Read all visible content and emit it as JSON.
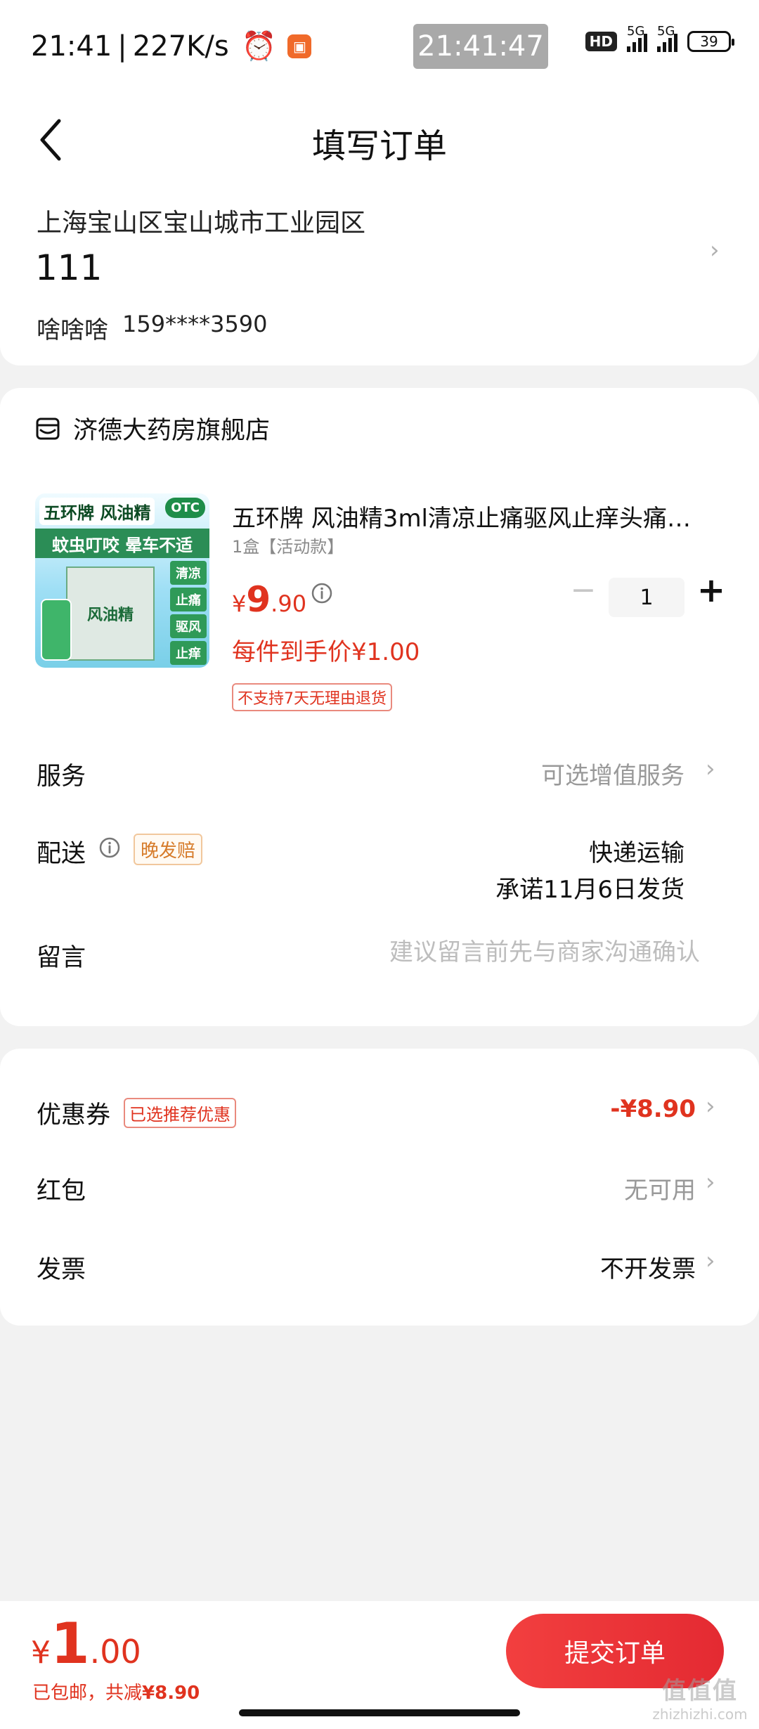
{
  "status_bar": {
    "time": "21:41",
    "separator": "|",
    "network_speed": "227K/s",
    "clock_overlay": "21:41:47",
    "hd_label": "HD",
    "net_1": "5G",
    "net_2": "5G",
    "battery": "39"
  },
  "header": {
    "title": "填写订单"
  },
  "address": {
    "region": "上海宝山区宝山城市工业园区",
    "detail": "111",
    "name": "啥啥啥",
    "phone": "159****3590"
  },
  "store": {
    "name": "济德大药房旗舰店",
    "product": {
      "image_brand": "五环牌 风油精",
      "image_otc": "OTC",
      "image_slogan": "蚊虫叮咬  晕车不适",
      "image_box": "风油精",
      "image_tags": [
        "清凉",
        "止痛",
        "驱风",
        "止痒"
      ],
      "title": "五环牌 风油精3ml清凉止痛驱风止痒头痛…",
      "spec": "1盒【活动款】",
      "price_currency": "¥",
      "price_integer": "9",
      "price_decimal": ".90",
      "final_price": "每件到手价¥1.00",
      "return_policy": "不支持7天无理由退货",
      "quantity": "1",
      "quantity_minus": "−",
      "quantity_plus": "+"
    },
    "service": {
      "label": "服务",
      "value": "可选增值服务"
    },
    "delivery": {
      "label": "配送",
      "tag": "晚发赔",
      "method": "快递运输",
      "promise": "承诺11月6日发货"
    },
    "message": {
      "label": "留言",
      "placeholder": "建议留言前先与商家沟通确认"
    }
  },
  "discounts": {
    "coupon": {
      "label": "优惠券",
      "tag": "已选推荐优惠",
      "value": "-¥8.90"
    },
    "red_packet": {
      "label": "红包",
      "value": "无可用"
    },
    "invoice": {
      "label": "发票",
      "value": "不开发票"
    }
  },
  "bottom": {
    "currency": "¥",
    "total_integer": "1",
    "total_decimal": ".00",
    "shipping": "已包邮，共减",
    "saved": "¥8.90",
    "submit_label": "提交订单"
  },
  "watermark": {
    "logo": "值值值",
    "site": "zhizhizhi.com"
  },
  "icons": {
    "back": "back-arrow-icon",
    "store": "store-icon",
    "info": "info-icon",
    "chevron": "chevron-right-icon",
    "alarm": "alarm-icon"
  },
  "colors": {
    "accent": "#e0331f",
    "tag_orange": "#d67b2a",
    "submit_button": "#f23f3f",
    "page_bg": "#f2f2f2"
  }
}
